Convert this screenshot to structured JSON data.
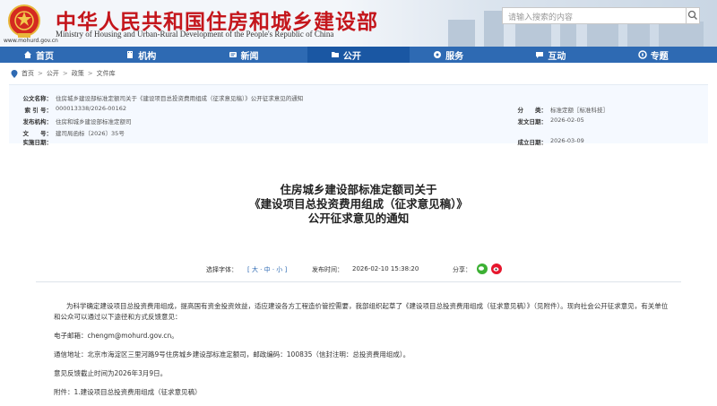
{
  "header": {
    "title": "中华人民共和国住房和城乡建设部",
    "subtitle": "Ministry of Housing and Urban-Rural Development of the People's Republic of China",
    "domain": "www.mohurd.gov.cn",
    "search_placeholder": "请输入搜索的内容"
  },
  "nav": {
    "items": [
      {
        "label": "首页",
        "icon": "home-icon"
      },
      {
        "label": "机构",
        "icon": "building-icon"
      },
      {
        "label": "新闻",
        "icon": "news-icon"
      },
      {
        "label": "公开",
        "icon": "folder-icon"
      },
      {
        "label": "服务",
        "icon": "service-icon"
      },
      {
        "label": "互动",
        "icon": "chat-icon"
      },
      {
        "label": "专题",
        "icon": "topic-icon"
      }
    ],
    "active_index": 3
  },
  "breadcrumb": [
    "首页",
    "公开",
    "政策",
    "文件库"
  ],
  "meta": {
    "title_label": "公文名称：",
    "title_value": "住房城乡建设部标准定额司关于《建设项目总投资费用组成（征求意见稿）》公开征求意见的通知",
    "index_label": "索 引 号：",
    "index_value": "000013338/2026-00162",
    "category_label": "分　　类：",
    "category_value": "标准定额［标准科技］",
    "issuer_label": "发布机构：",
    "issuer_value": "住房和城乡建设部标准定额司",
    "issue_date_label": "发文日期：",
    "issue_date_value": "2026-02-05",
    "doc_no_label": "文　　号：",
    "doc_no_value": "建司局函标〔2026〕35号",
    "effective_label": "实施日期：",
    "effective_value": "",
    "publish_label": "成立日期：",
    "publish_value": "2026-03-09"
  },
  "doc_title": {
    "line1": "住房城乡建设部标准定额司关于",
    "line2": "《建设项目总投资费用组成（征求意见稿）》",
    "line3": "公开征求意见的通知"
  },
  "toolbar": {
    "font_label": "选择字体：",
    "font_options": "[ 大 · 中 · 小 ]",
    "time_label": "发布时间：",
    "time_value": "2026-02-10 15:38:20",
    "share_label": "分享："
  },
  "content": {
    "p1": "为科学确定建设项目总投资费用组成，提高国有资金投资效益，适应建设各方工程造价管控需要，我部组织起草了《建设项目总投资费用组成（征求意见稿）》（见附件）。现向社会公开征求意见，有关单位和公众可以通过以下途径和方式反馈意见：",
    "email": "电子邮箱：chengm@mohurd.gov.cn。",
    "address": "通信地址：北京市海淀区三里河路9号住房城乡建设部标准定额司，邮政编码：100835（信封注明：总投资费用组成）。",
    "deadline": "意见反馈截止时间为2026年3月9日。",
    "attachment": "附件：1.建设项目总投资费用组成（征求意见稿）"
  },
  "colors": {
    "nav_bg": "#2e6ab3",
    "title_red": "#c4161c",
    "meta_bg": "#f5f9ff"
  }
}
